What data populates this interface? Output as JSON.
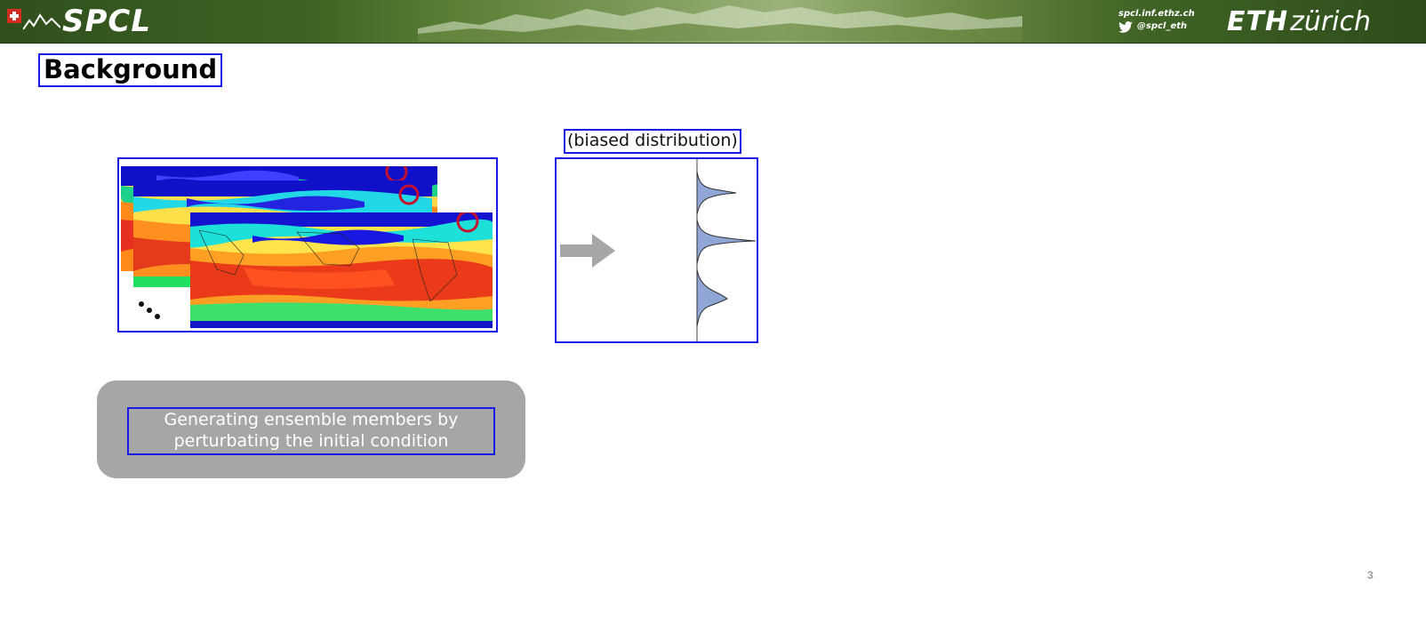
{
  "header": {
    "logo_text": "SPCL",
    "url": "spcl.inf.ethz.ch",
    "twitter": "@spcl_eth",
    "eth_bold": "ETH",
    "eth_rest": "zürich",
    "colors": {
      "banner_dark": "#2f4f1c",
      "banner_light": "#9bb27a"
    }
  },
  "slide": {
    "title": "Background",
    "distribution_label": "(biased distribution)",
    "caption_line1": "Generating ensemble members by",
    "caption_line2": "perturbating the initial condition",
    "page_number": "3"
  },
  "icons": {
    "flag": "swiss-flag-icon",
    "mountains": "mountains-icon",
    "twitter": "twitter-icon",
    "arrow": "right-arrow-icon",
    "dots": "ellipsis-dots-icon"
  },
  "colors": {
    "highlight_border": "#1a1ae6",
    "caption_box": "#a6a6a6",
    "distribution_fill": "#8fa6d6",
    "arrow": "#a6a6a6",
    "circle_marker": "#c8102e"
  }
}
